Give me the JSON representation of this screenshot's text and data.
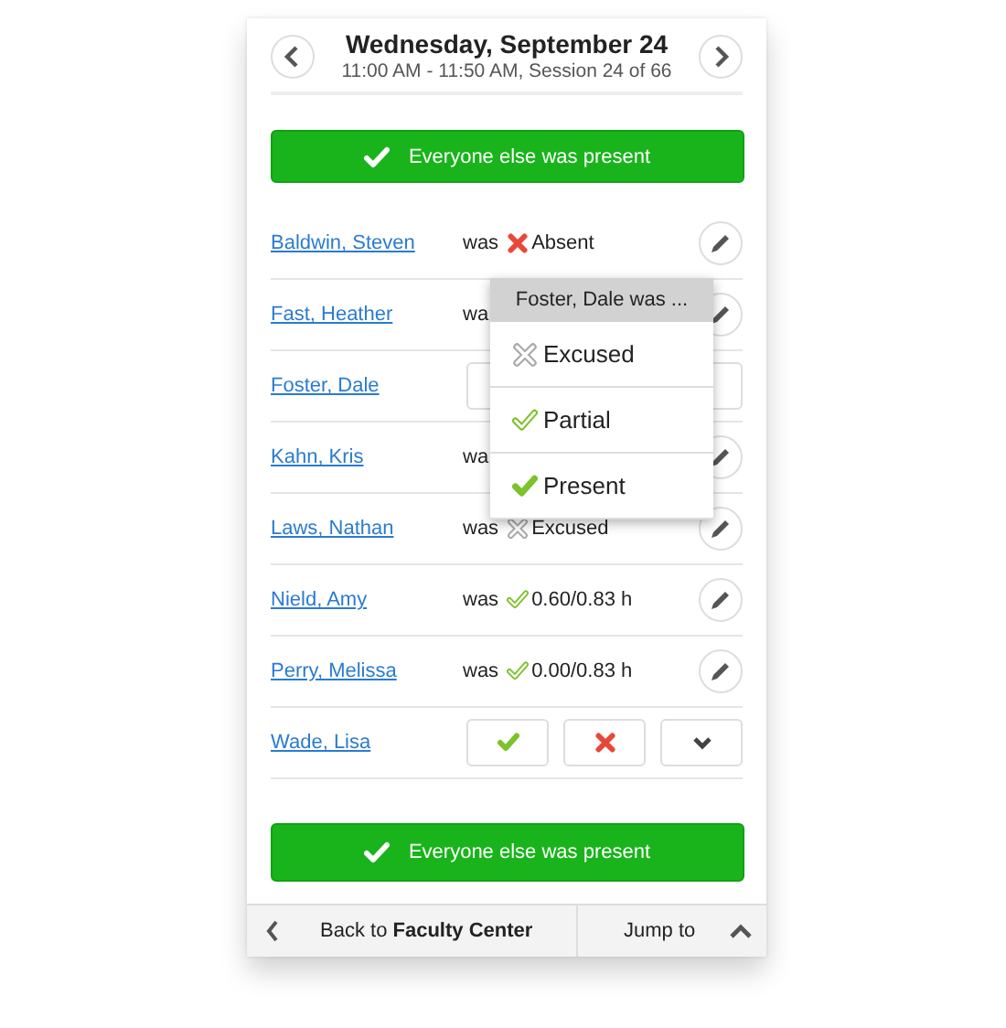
{
  "header": {
    "title": "Wednesday, September 24",
    "subtitle": "11:00 AM - 11:50 AM, Session 24 of 66"
  },
  "top_button": "Everyone else was present",
  "students": [
    {
      "name": "Baldwin, Steven",
      "kind": "recorded",
      "was": "was",
      "status": {
        "kind": "absent",
        "text": "Absent"
      }
    },
    {
      "name": "Fast, Heather",
      "kind": "recorded",
      "was": "wa"
    },
    {
      "name": "Foster, Dale",
      "kind": "covered"
    },
    {
      "name": "Kahn, Kris",
      "kind": "recorded",
      "was": "wa"
    },
    {
      "name": "Laws, Nathan",
      "kind": "recorded",
      "was": "was",
      "status": {
        "kind": "excused",
        "text": "Excused"
      }
    },
    {
      "name": "Nield, Amy",
      "kind": "recorded",
      "was": "was",
      "status": {
        "kind": "partial",
        "text": "0.60/0.83 h"
      }
    },
    {
      "name": "Perry, Melissa",
      "kind": "recorded",
      "was": "was",
      "status": {
        "kind": "partial",
        "text": "0.00/0.83 h"
      }
    },
    {
      "name": "Wade, Lisa",
      "kind": "pending"
    }
  ],
  "popup": {
    "title": "Foster, Dale was ...",
    "items": [
      {
        "kind": "excused",
        "label": "Excused"
      },
      {
        "kind": "partial",
        "label": "Partial"
      },
      {
        "kind": "present",
        "label": "Present"
      }
    ]
  },
  "bottom_button": "Everyone else was present",
  "footer": {
    "back": "Back to **Faculty Center**",
    "jump": "Jump to"
  }
}
